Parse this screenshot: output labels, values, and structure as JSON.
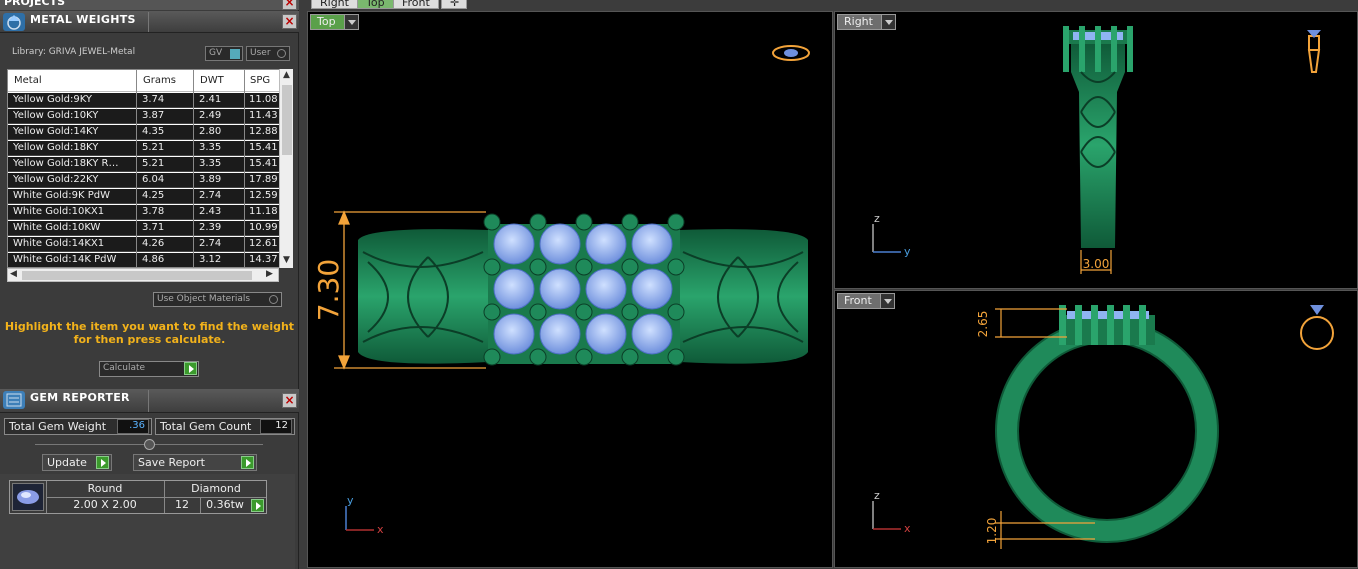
{
  "projects": {
    "title": "PROJECTS"
  },
  "metal_weights": {
    "title": "METAL WEIGHTS",
    "library": "Library: GRIVA JEWEL-Metal",
    "gv_label": "GV",
    "user_label": "User",
    "columns": [
      "Metal",
      "Grams",
      "DWT",
      "SPG"
    ],
    "rows": [
      [
        "Yellow Gold:9KY",
        "3.74",
        "2.41",
        "11.08"
      ],
      [
        "Yellow Gold:10KY",
        "3.87",
        "2.49",
        "11.43"
      ],
      [
        "Yellow Gold:14KY",
        "4.35",
        "2.80",
        "12.88"
      ],
      [
        "Yellow Gold:18KY",
        "5.21",
        "3.35",
        "15.41"
      ],
      [
        "Yellow Gold:18KY R…",
        "5.21",
        "3.35",
        "15.41"
      ],
      [
        "Yellow Gold:22KY",
        "6.04",
        "3.89",
        "17.89"
      ],
      [
        "White Gold:9K PdW",
        "4.25",
        "2.74",
        "12.59"
      ],
      [
        "White Gold:10KX1",
        "3.78",
        "2.43",
        "11.18"
      ],
      [
        "White Gold:10KW",
        "3.71",
        "2.39",
        "10.99"
      ],
      [
        "White Gold:14KX1",
        "4.26",
        "2.74",
        "12.61"
      ],
      [
        "White Gold:14K PdW",
        "4.86",
        "3.12",
        "14.37"
      ]
    ],
    "use_object_materials": "Use Object Materials",
    "hint_line1": "Highlight the item you want to find the weight",
    "hint_line2": "for then press calculate.",
    "calculate_label": "Calculate"
  },
  "gem_reporter": {
    "title": "GEM REPORTER",
    "total_weight_label": "Total Gem Weight",
    "total_weight_value": ".36",
    "total_count_label": "Total Gem Count",
    "total_count_value": "12",
    "update_label": "Update",
    "save_report_label": "Save Report",
    "gem": {
      "shape": "Round",
      "size": "2.00 X 2.00",
      "type": "Diamond",
      "count": "12",
      "weight": "0.36tw"
    }
  },
  "top_tabs": [
    "Right",
    "Top",
    "Front"
  ],
  "viewports": {
    "top": {
      "label": "Top",
      "dimension": "7.30",
      "axis_y": "y",
      "axis_x": "x"
    },
    "right": {
      "label": "Right",
      "dimension": "3.00",
      "axis_z": "z",
      "axis_y": "y"
    },
    "front": {
      "label": "Front",
      "dimension_top": "2.65",
      "dimension_bottom": "1.20",
      "axis_z": "z",
      "axis_x": "x"
    }
  },
  "colors": {
    "metal": "#1f8a5a",
    "gem": "#8fb4f2",
    "dimension": "#f2a33a",
    "accent_hint": "#f2b21b"
  }
}
